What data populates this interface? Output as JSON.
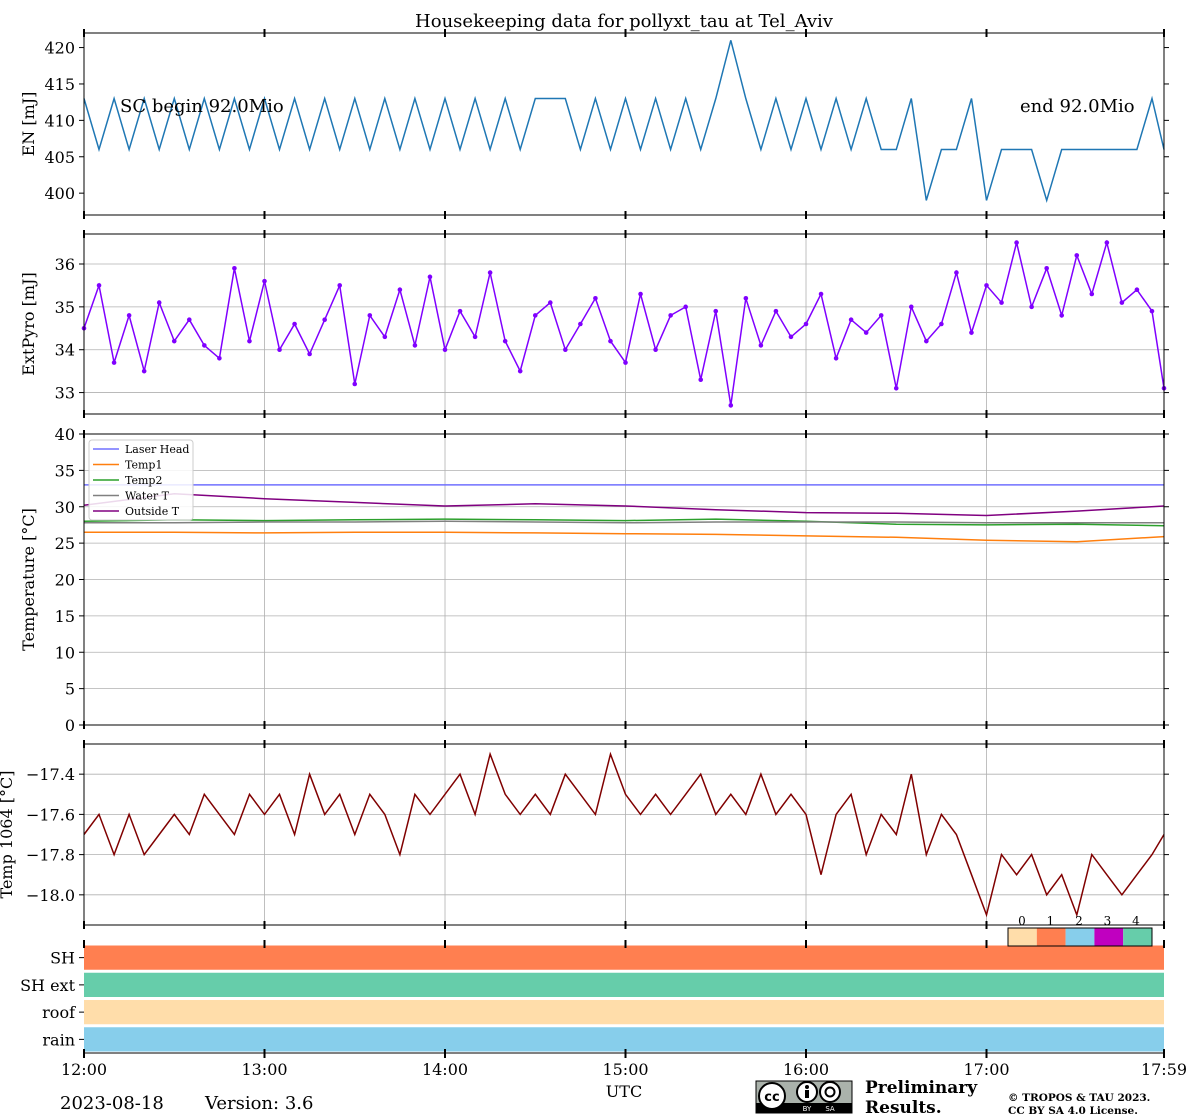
{
  "title": "Housekeeping data for pollyxt_tau at Tel_Aviv",
  "date": "2023-08-18",
  "version": "Version: 3.6",
  "xlabel": "UTC",
  "preliminary": [
    "Preliminary",
    "Results."
  ],
  "copyright": [
    "© TROPOS & TAU 2023.",
    "CC BY SA 4.0 License."
  ],
  "license_badge": {
    "labels": [
      "BY",
      "SA"
    ]
  },
  "colors": {
    "energy": "#1f77b4",
    "extpyro": "#8000ff",
    "temp1064": "#800000",
    "laser_head": "#7070ff",
    "temp1": "#ff7f0e",
    "temp2": "#2ca02c",
    "water_t": "#808080",
    "outside_t": "#800080",
    "preliminary": "#e83030"
  },
  "chart_data": [
    {
      "id": "energy",
      "type": "line",
      "ylabel": "EN [mJ]",
      "xlim": [
        "12:00",
        "17:59"
      ],
      "ylim": [
        397,
        422
      ],
      "yticks": [
        400,
        405,
        410,
        415,
        420
      ],
      "annotations": [
        "SC begin 92.0Mio",
        "end 92.0Mio"
      ],
      "x": [
        "12:00",
        "12:05",
        "12:10",
        "12:15",
        "12:20",
        "12:25",
        "12:30",
        "12:35",
        "12:40",
        "12:45",
        "12:50",
        "12:55",
        "13:00",
        "13:05",
        "13:10",
        "13:15",
        "13:20",
        "13:25",
        "13:30",
        "13:35",
        "13:40",
        "13:45",
        "13:50",
        "13:55",
        "14:00",
        "14:05",
        "14:10",
        "14:15",
        "14:20",
        "14:25",
        "14:30",
        "14:35",
        "14:40",
        "14:45",
        "14:50",
        "14:55",
        "15:00",
        "15:05",
        "15:10",
        "15:15",
        "15:20",
        "15:25",
        "15:30",
        "15:35",
        "15:40",
        "15:45",
        "15:50",
        "15:55",
        "16:00",
        "16:05",
        "16:10",
        "16:15",
        "16:20",
        "16:25",
        "16:30",
        "16:35",
        "16:40",
        "16:45",
        "16:50",
        "16:55",
        "17:00",
        "17:05",
        "17:10",
        "17:15",
        "17:20",
        "17:25",
        "17:30",
        "17:35",
        "17:40",
        "17:45",
        "17:50",
        "17:55",
        "17:59"
      ],
      "values": [
        413,
        406,
        413,
        406,
        413,
        406,
        413,
        406,
        413,
        406,
        413,
        406,
        413,
        406,
        413,
        406,
        413,
        406,
        413,
        406,
        413,
        406,
        413,
        406,
        413,
        406,
        413,
        406,
        413,
        406,
        413,
        413,
        413,
        406,
        413,
        406,
        413,
        406,
        413,
        406,
        413,
        406,
        413,
        421,
        413,
        406,
        413,
        406,
        413,
        406,
        413,
        406,
        413,
        406,
        406,
        413,
        399,
        406,
        406,
        413,
        399,
        406,
        406,
        406,
        399,
        406,
        406,
        406,
        406,
        406,
        406,
        413,
        406
      ],
      "gridlines": false
    },
    {
      "id": "extpyro",
      "type": "line",
      "ylabel": "ExtPyro [mJ]",
      "xlim": [
        "12:00",
        "17:59"
      ],
      "ylim": [
        32.5,
        36.7
      ],
      "yticks": [
        33,
        34,
        35,
        36
      ],
      "x": [
        "12:00",
        "12:05",
        "12:10",
        "12:15",
        "12:20",
        "12:25",
        "12:30",
        "12:35",
        "12:40",
        "12:45",
        "12:50",
        "12:55",
        "13:00",
        "13:05",
        "13:10",
        "13:15",
        "13:20",
        "13:25",
        "13:30",
        "13:35",
        "13:40",
        "13:45",
        "13:50",
        "13:55",
        "14:00",
        "14:05",
        "14:10",
        "14:15",
        "14:20",
        "14:25",
        "14:30",
        "14:35",
        "14:40",
        "14:45",
        "14:50",
        "14:55",
        "15:00",
        "15:05",
        "15:10",
        "15:15",
        "15:20",
        "15:25",
        "15:30",
        "15:35",
        "15:40",
        "15:45",
        "15:50",
        "15:55",
        "16:00",
        "16:05",
        "16:10",
        "16:15",
        "16:20",
        "16:25",
        "16:30",
        "16:35",
        "16:40",
        "16:45",
        "16:50",
        "16:55",
        "17:00",
        "17:05",
        "17:10",
        "17:15",
        "17:20",
        "17:25",
        "17:30",
        "17:35",
        "17:40",
        "17:45",
        "17:50",
        "17:55",
        "17:59"
      ],
      "values": [
        34.5,
        35.5,
        33.7,
        34.8,
        33.5,
        35.1,
        34.2,
        34.7,
        34.1,
        33.8,
        35.9,
        34.2,
        35.6,
        34.0,
        34.6,
        33.9,
        34.7,
        35.5,
        33.2,
        34.8,
        34.3,
        35.4,
        34.1,
        35.7,
        34.0,
        34.9,
        34.3,
        35.8,
        34.2,
        33.5,
        34.8,
        35.1,
        34.0,
        34.6,
        35.2,
        34.2,
        33.7,
        35.3,
        34.0,
        34.8,
        35.0,
        33.3,
        34.9,
        32.7,
        35.2,
        34.1,
        34.9,
        34.3,
        34.6,
        35.3,
        33.8,
        34.7,
        34.4,
        34.8,
        33.1,
        35.0,
        34.2,
        34.6,
        35.8,
        34.4,
        35.5,
        35.1,
        36.5,
        35.0,
        35.9,
        34.8,
        36.2,
        35.3,
        36.5,
        35.1,
        35.4,
        34.9,
        33.1
      ],
      "gridlines": true
    },
    {
      "id": "temperature",
      "type": "line",
      "ylabel": "Temperature [$^\\circ$C]",
      "xlim": [
        "12:00",
        "17:59"
      ],
      "ylim": [
        0,
        40
      ],
      "yticks": [
        0,
        5,
        10,
        15,
        20,
        25,
        30,
        35,
        40
      ],
      "legend": "top-left",
      "gridlines": true,
      "x": [
        "12:00",
        "12:30",
        "13:00",
        "13:30",
        "14:00",
        "14:30",
        "15:00",
        "15:30",
        "16:00",
        "16:30",
        "17:00",
        "17:30",
        "17:59"
      ],
      "series": [
        {
          "name": "Laser Head",
          "color_key": "laser_head",
          "values": [
            33.0,
            33.0,
            33.0,
            33.0,
            33.0,
            33.0,
            33.0,
            33.0,
            33.0,
            33.0,
            33.0,
            33.0,
            33.0
          ]
        },
        {
          "name": "Temp1",
          "color_key": "temp1",
          "values": [
            26.5,
            26.5,
            26.4,
            26.5,
            26.5,
            26.4,
            26.3,
            26.2,
            26.0,
            25.8,
            25.4,
            25.2,
            25.9
          ]
        },
        {
          "name": "Temp2",
          "color_key": "temp2",
          "values": [
            28.0,
            28.2,
            28.1,
            28.2,
            28.3,
            28.2,
            28.1,
            28.3,
            28.0,
            27.6,
            27.5,
            27.6,
            27.4
          ]
        },
        {
          "name": "Water T",
          "color_key": "water_t",
          "values": [
            27.8,
            27.8,
            27.9,
            27.9,
            28.0,
            27.9,
            27.8,
            27.9,
            27.9,
            27.9,
            27.8,
            27.8,
            27.8
          ]
        },
        {
          "name": "Outside T",
          "color_key": "outside_t",
          "values": [
            30.2,
            31.8,
            31.1,
            30.6,
            30.1,
            30.4,
            30.1,
            29.6,
            29.2,
            29.1,
            28.8,
            29.4,
            30.1
          ]
        }
      ]
    },
    {
      "id": "temp1064",
      "type": "line",
      "ylabel": "Temp 1064 [$^\\circ$C]",
      "xlim": [
        "12:00",
        "17:59"
      ],
      "ylim": [
        -18.15,
        -17.25
      ],
      "yticks": [
        -17.4,
        -17.6,
        -17.8,
        -18.0
      ],
      "ytick_labels": [
        "−17.4",
        "−17.6",
        "−17.8",
        "−18.0"
      ],
      "x": [
        "12:00",
        "12:05",
        "12:10",
        "12:15",
        "12:20",
        "12:25",
        "12:30",
        "12:35",
        "12:40",
        "12:45",
        "12:50",
        "12:55",
        "13:00",
        "13:05",
        "13:10",
        "13:15",
        "13:20",
        "13:25",
        "13:30",
        "13:35",
        "13:40",
        "13:45",
        "13:50",
        "13:55",
        "14:00",
        "14:05",
        "14:10",
        "14:15",
        "14:20",
        "14:25",
        "14:30",
        "14:35",
        "14:40",
        "14:45",
        "14:50",
        "14:55",
        "15:00",
        "15:05",
        "15:10",
        "15:15",
        "15:20",
        "15:25",
        "15:30",
        "15:35",
        "15:40",
        "15:45",
        "15:50",
        "15:55",
        "16:00",
        "16:05",
        "16:10",
        "16:15",
        "16:20",
        "16:25",
        "16:30",
        "16:35",
        "16:40",
        "16:45",
        "16:50",
        "16:55",
        "17:00",
        "17:05",
        "17:10",
        "17:15",
        "17:20",
        "17:25",
        "17:30",
        "17:35",
        "17:40",
        "17:45",
        "17:50",
        "17:55",
        "17:59"
      ],
      "values": [
        -17.7,
        -17.6,
        -17.8,
        -17.6,
        -17.8,
        -17.7,
        -17.6,
        -17.7,
        -17.5,
        -17.6,
        -17.7,
        -17.5,
        -17.6,
        -17.5,
        -17.7,
        -17.4,
        -17.6,
        -17.5,
        -17.7,
        -17.5,
        -17.6,
        -17.8,
        -17.5,
        -17.6,
        -17.5,
        -17.4,
        -17.6,
        -17.3,
        -17.5,
        -17.6,
        -17.5,
        -17.6,
        -17.4,
        -17.5,
        -17.6,
        -17.3,
        -17.5,
        -17.6,
        -17.5,
        -17.6,
        -17.5,
        -17.4,
        -17.6,
        -17.5,
        -17.6,
        -17.4,
        -17.6,
        -17.5,
        -17.6,
        -17.9,
        -17.6,
        -17.5,
        -17.8,
        -17.6,
        -17.7,
        -17.4,
        -17.8,
        -17.6,
        -17.7,
        -17.9,
        -18.1,
        -17.8,
        -17.9,
        -17.8,
        -18.0,
        -17.9,
        -18.1,
        -17.8,
        -17.9,
        -18.0,
        -17.9,
        -17.8,
        -17.7
      ],
      "gridlines": true
    },
    {
      "id": "status",
      "type": "heatmap",
      "rows": [
        "SH",
        "SH ext",
        "roof",
        "rain"
      ],
      "row_values": [
        1,
        4,
        0,
        2
      ],
      "colorbar": {
        "ticks": [
          "0",
          "1",
          "2",
          "3",
          "4"
        ],
        "colors": [
          "#ffddaa",
          "#ff7f50",
          "#87ceeb",
          "#c000c0",
          "#66cdaa"
        ]
      },
      "xticks": [
        "12:00",
        "13:00",
        "14:00",
        "15:00",
        "16:00",
        "17:00",
        "17:59"
      ]
    }
  ]
}
